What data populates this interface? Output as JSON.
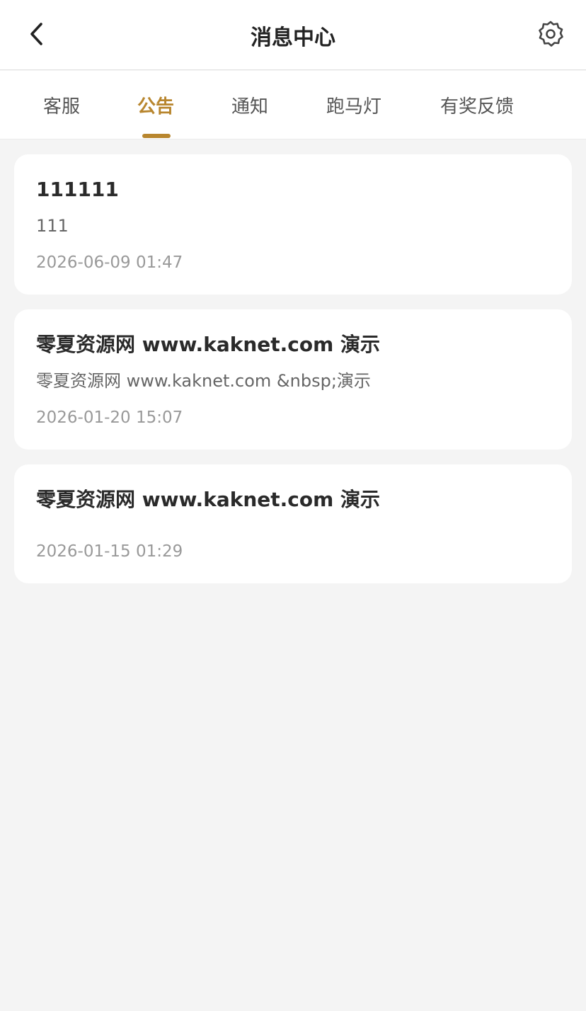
{
  "header": {
    "title": "消息中心",
    "back_icon": "chevron-left-icon",
    "settings_icon": "gear-icon"
  },
  "tabs": [
    {
      "label": "客服",
      "active": false
    },
    {
      "label": "公告",
      "active": true
    },
    {
      "label": "通知",
      "active": false
    },
    {
      "label": "跑马灯",
      "active": false
    },
    {
      "label": "有奖反馈",
      "active": false
    }
  ],
  "colors": {
    "accent": "#b8862e",
    "background": "#f4f4f4",
    "card": "#ffffff"
  },
  "messages": [
    {
      "title": "111111",
      "body": "111",
      "time": "2026-06-09 01:47"
    },
    {
      "title": "零夏资源网 www.kaknet.com 演示",
      "body": "零夏资源网 www.kaknet.com &nbsp;演示",
      "time": "2026-01-20 15:07"
    },
    {
      "title": "零夏资源网 www.kaknet.com 演示",
      "body": "",
      "time": "2026-01-15 01:29"
    }
  ]
}
